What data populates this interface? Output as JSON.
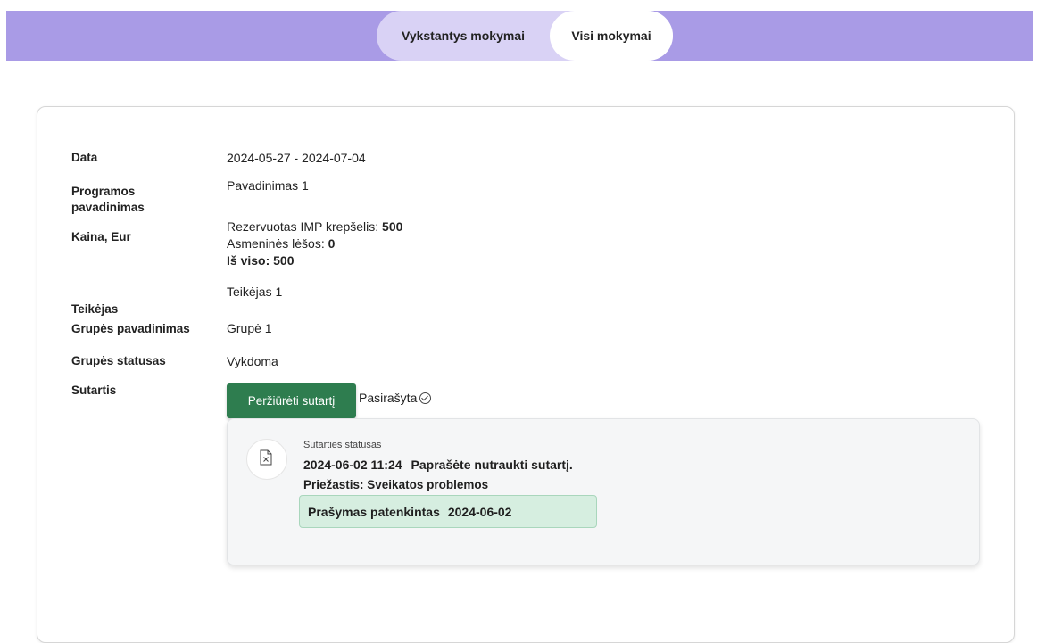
{
  "tabs": [
    {
      "label": "Vykstantys mokymai"
    },
    {
      "label": "Visi mokymai"
    }
  ],
  "details": {
    "date_label": "Data",
    "date_value": "2024-05-27 - 2024-07-04",
    "program_label": "Programos pavadinimas",
    "program_value": "Pavadinimas 1",
    "price_label": "Kaina, Eur",
    "price_reserved_label": "Rezervuotas IMP krepšelis:",
    "price_reserved_value": "500",
    "price_own_label": "Asmeninės lėšos:",
    "price_own_value": "0",
    "price_total": "Iš viso: 500",
    "provider_label": "Teikėjas",
    "provider_value": "Teikėjas 1",
    "group_name_label": "Grupės pavadinimas",
    "group_name_value": "Grupė 1",
    "group_status_label": "Grupės statusas",
    "group_status_value": "Vykdoma",
    "contract_label": "Sutartis"
  },
  "contract": {
    "view_button": "Peržiūrėti sutartį",
    "signed_text": "Pasirašyta",
    "status_title": "Sutarties statusas",
    "status_datetime": "2024-06-02 11:24",
    "status_message": "Paprašėte nutraukti sutartį.",
    "reason": "Priežastis: Sveikatos problemos",
    "request_status": "Prašymas patenkintas",
    "request_date": "2024-06-02"
  },
  "colors": {
    "topbar": "#a99be6",
    "tab_inactive": "#d9d2f5",
    "button_green": "#2e7d4f",
    "success_bg": "#d6eee0"
  }
}
